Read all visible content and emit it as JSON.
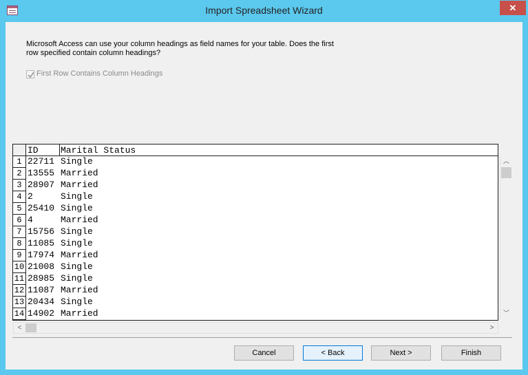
{
  "window": {
    "title": "Import Spreadsheet Wizard",
    "close_label": "✕"
  },
  "prompt": "Microsoft Access can use your column headings as field names for your table. Does the first row specified contain column headings?",
  "checkbox": {
    "label": "First Row Contains Column Headings",
    "checked": true,
    "enabled": false
  },
  "grid": {
    "columns": [
      "ID",
      "Marital Status"
    ],
    "rows": [
      {
        "n": "1",
        "id": "22711",
        "ms": "Single"
      },
      {
        "n": "2",
        "id": "13555",
        "ms": "Married"
      },
      {
        "n": "3",
        "id": "28907",
        "ms": "Married"
      },
      {
        "n": "4",
        "id": "2",
        "ms": "Single"
      },
      {
        "n": "5",
        "id": "25410",
        "ms": "Single"
      },
      {
        "n": "6",
        "id": "4",
        "ms": "Married"
      },
      {
        "n": "7",
        "id": "15756",
        "ms": "Single"
      },
      {
        "n": "8",
        "id": "11085",
        "ms": "Single"
      },
      {
        "n": "9",
        "id": "17974",
        "ms": "Married"
      },
      {
        "n": "10",
        "id": "21008",
        "ms": "Single"
      },
      {
        "n": "11",
        "id": "28985",
        "ms": "Single"
      },
      {
        "n": "12",
        "id": "11087",
        "ms": "Married"
      },
      {
        "n": "13",
        "id": "20434",
        "ms": "Single"
      },
      {
        "n": "14",
        "id": "14902",
        "ms": "Married"
      }
    ]
  },
  "scroll": {
    "up": "︿",
    "down": "﹀",
    "left": "<",
    "right": ">"
  },
  "buttons": {
    "cancel": "Cancel",
    "back": "< Back",
    "next": "Next >",
    "finish": "Finish"
  }
}
